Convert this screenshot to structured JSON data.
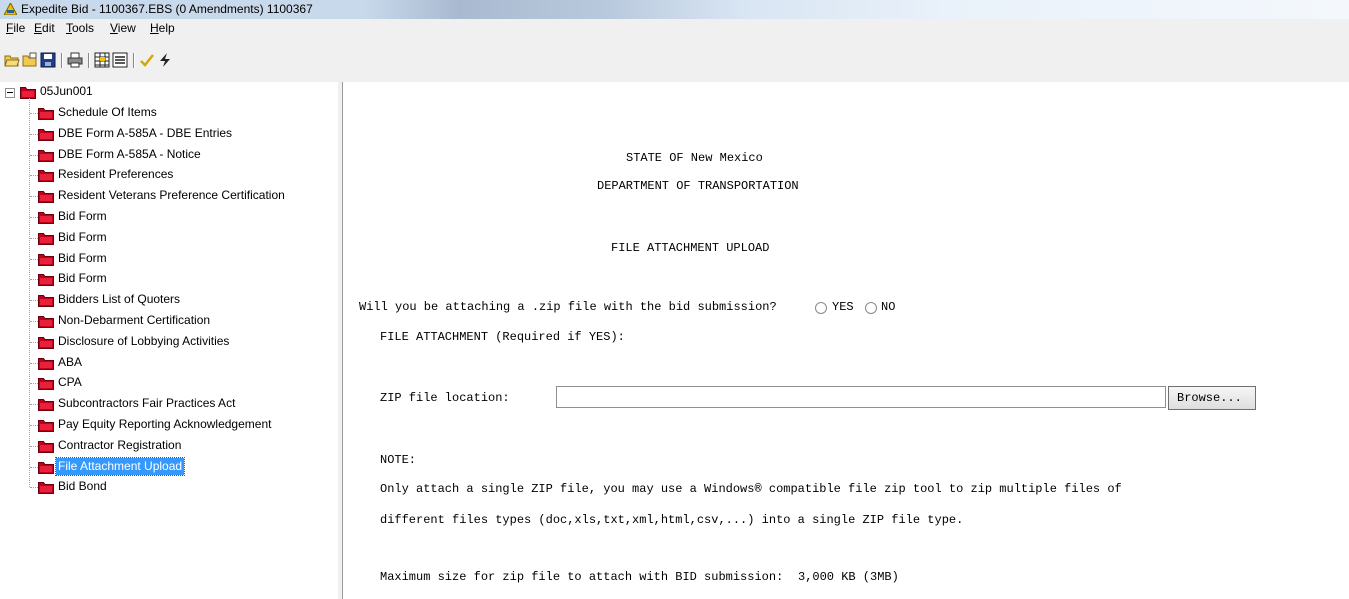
{
  "window": {
    "title": "Expedite Bid - 1100367.EBS (0 Amendments) 1100367"
  },
  "menu": [
    "File",
    "Edit",
    "Tools",
    "View",
    "Help"
  ],
  "toolbar": [
    "open-folder-icon",
    "open-icon",
    "save-icon",
    "print-icon",
    "grid-icon",
    "list-icon",
    "check-icon",
    "lightning-icon"
  ],
  "tree": {
    "root": "05Jun001",
    "items": [
      "Schedule Of Items",
      "DBE Form A-585A - DBE Entries",
      "DBE Form A-585A - Notice",
      "Resident Preferences",
      "Resident Veterans Preference Certification",
      "Bid Form",
      "Bid Form",
      "Bid Form",
      "Bid Form",
      "Bidders List of Quoters",
      "Non-Debarment Certification",
      "Disclosure of Lobbying Activities",
      "ABA",
      "CPA",
      "Subcontractors Fair Practices Act",
      "Pay Equity Reporting Acknowledgement",
      "Contractor Registration",
      "File Attachment Upload",
      "Bid Bond"
    ],
    "selected": "File Attachment Upload"
  },
  "content": {
    "state": "STATE OF New Mexico",
    "dept": "DEPARTMENT OF TRANSPORTATION",
    "heading": "FILE ATTACHMENT UPLOAD",
    "question": "Will you be attaching a .zip file with the bid submission?",
    "yes_label": "YES",
    "no_label": "NO",
    "attach_label": "FILE ATTACHMENT (Required if YES):",
    "zip_label": "ZIP file location:",
    "zip_value": "",
    "browse_label": "Browse...",
    "note_label": "NOTE:",
    "note_line1": "Only attach a single ZIP file, you may use a Windows® compatible file zip tool to zip multiple files of",
    "note_line2": "different files types (doc,xls,txt,xml,html,csv,...) into a single ZIP file type.",
    "max_label": "Maximum size for zip file to attach with BID submission:",
    "max_value": "3,000 KB (3MB)"
  }
}
